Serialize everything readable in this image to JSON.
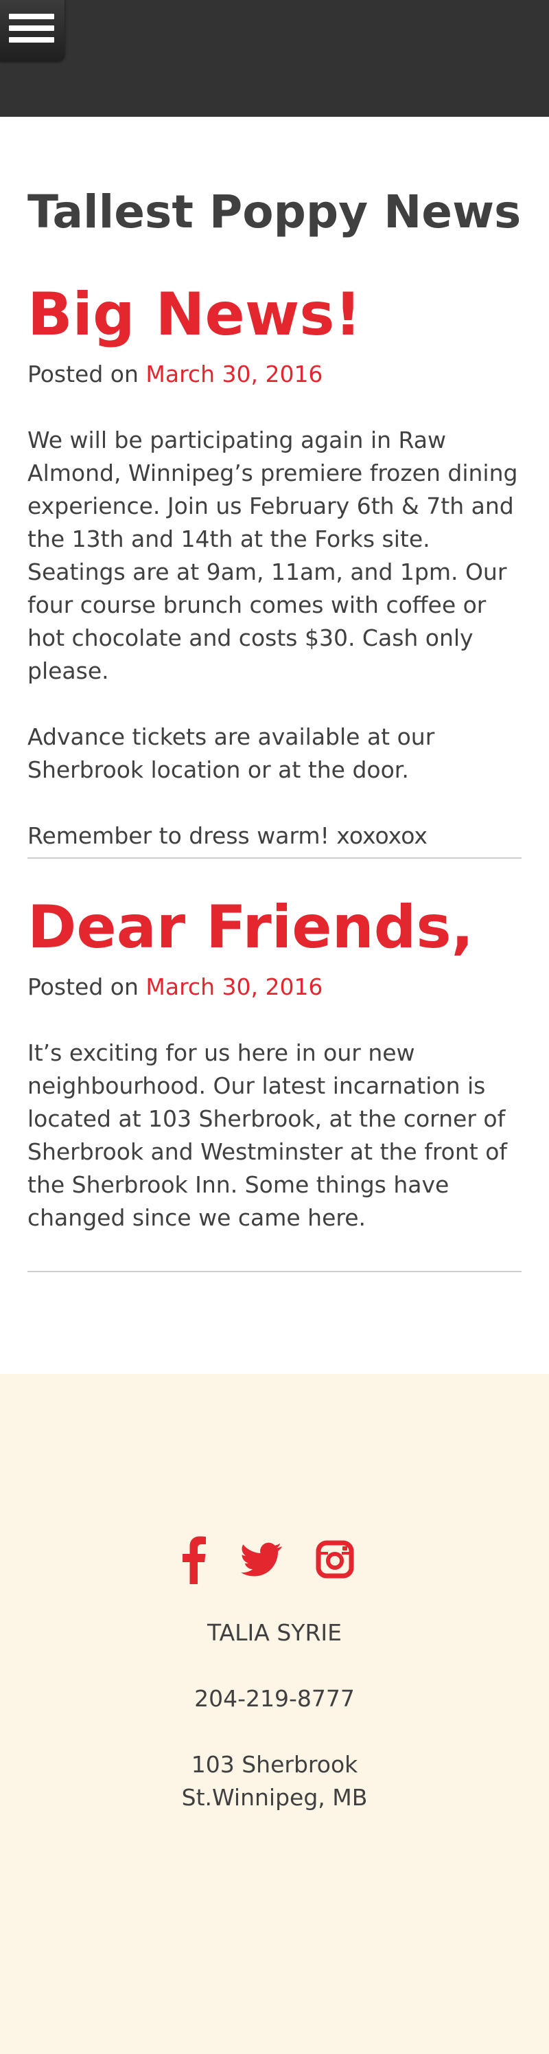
{
  "header": {
    "menu_icon": "hamburger-menu-icon"
  },
  "site": {
    "title": "Tallest Poppy News"
  },
  "colors": {
    "accent": "#e4262f",
    "text": "#404040",
    "header_bg": "#333333",
    "footer_bg": "#fdf5e6"
  },
  "posts": [
    {
      "title": "Big News!",
      "posted_on": "Posted on",
      "date": "March 30, 2016",
      "paragraphs": [
        "We will be participating again in Raw Almond, Winnipeg’s premiere frozen dining experience. Join us February 6th & 7th and the 13th and 14th at the Forks site. Seatings are at 9am, 11am, and 1pm. Our four course brunch comes with coffee or hot chocolate and costs $30. Cash only please.",
        "Advance tickets are available at our Sherbrook location or at the door.",
        "Remember to dress warm! xoxoxox"
      ]
    },
    {
      "title": "Dear Friends,",
      "posted_on": "Posted on",
      "date": "March 30, 2016",
      "paragraphs": [
        "It’s exciting for us here in our new neighbourhood. Our latest incarnation is located at 103 Sherbrook, at the corner of Sherbrook and Westminster at the front of the Sherbrook Inn. Some things have changed since we came here."
      ]
    }
  ],
  "footer": {
    "social_icons": [
      "facebook-icon",
      "twitter-icon",
      "instagram-icon"
    ],
    "name": "TALIA SYRIE",
    "phone": "204-219-8777",
    "address_line1": "103 Sherbrook",
    "address_line2": "St.Winnipeg, MB"
  }
}
